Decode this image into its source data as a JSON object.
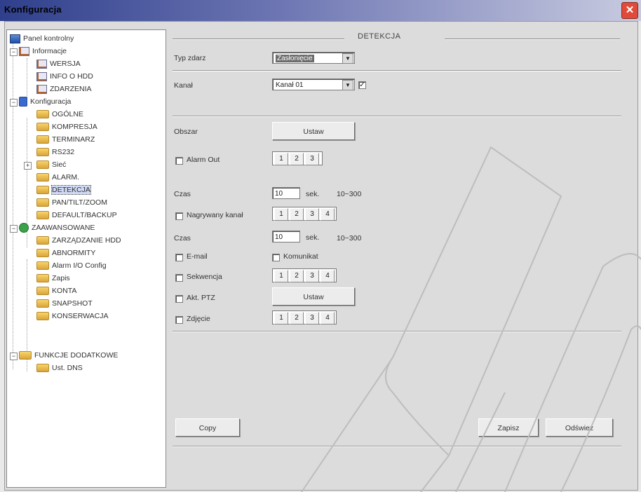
{
  "window": {
    "title": "Konfiguracja",
    "close_symbol": "✕"
  },
  "tree": {
    "items": [
      {
        "label": "Panel kontrolny",
        "icon": "panel-icon"
      },
      {
        "label": "Informacje",
        "icon": "notes-icon"
      },
      {
        "label": "WERSJA",
        "icon": "notes-icon"
      },
      {
        "label": "INFO O HDD",
        "icon": "notes-icon"
      },
      {
        "label": "ZDARZENIA",
        "icon": "notes-icon"
      },
      {
        "label": "Konfiguracja",
        "icon": "gear-icon"
      },
      {
        "label": "OGÓLNE",
        "icon": "folder-icon"
      },
      {
        "label": "KOMPRESJA",
        "icon": "folder-icon"
      },
      {
        "label": "TERMINARZ",
        "icon": "folder-icon"
      },
      {
        "label": "RS232",
        "icon": "folder-icon"
      },
      {
        "label": "Sieć",
        "icon": "folder-icon"
      },
      {
        "label": "ALARM.",
        "icon": "folder-icon"
      },
      {
        "label": "DETEKCJA",
        "icon": "folder-icon"
      },
      {
        "label": "PAN/TILT/ZOOM",
        "icon": "folder-icon"
      },
      {
        "label": "DEFAULT/BACKUP",
        "icon": "folder-icon"
      },
      {
        "label": "ZAAWANSOWANE",
        "icon": "chip-icon"
      },
      {
        "label": "ZARZĄDZANIE HDD",
        "icon": "folder-icon"
      },
      {
        "label": "ABNORMITY",
        "icon": "folder-icon"
      },
      {
        "label": "Alarm I/O Config",
        "icon": "folder-icon"
      },
      {
        "label": "Zapis",
        "icon": "folder-icon"
      },
      {
        "label": "KONTA",
        "icon": "folder-icon"
      },
      {
        "label": "SNAPSHOT",
        "icon": "folder-icon"
      },
      {
        "label": "KONSERWACJA",
        "icon": "folder-icon"
      },
      {
        "label": "FUNKCJE DODATKOWE",
        "icon": "folder-icon"
      },
      {
        "label": "Ust. DNS",
        "icon": "folder-icon"
      }
    ],
    "selected": "DETEKCJA"
  },
  "panel": {
    "section_title": "DETEKCJA",
    "typ_label": "Typ zdarz",
    "typ_value": "Zasłonięcie",
    "kanal_label": "Kanał",
    "kanal_value": "Kanał 01",
    "kanal_checked": "✓",
    "obszar_label": "Obszar",
    "ustaw_label": "Ustaw",
    "alarm_out_label": "Alarm Out",
    "czas_label": "Czas",
    "czas1_value": "10",
    "sek_label": "sek.",
    "range_label": "10~300",
    "nagrywany_label": "Nagrywany kanał",
    "czas2_value": "10",
    "email_label": "E-mail",
    "komunikat_label": "Komunikat",
    "sekwencja_label": "Sekwencja",
    "akt_ptz_label": "Akt. PTZ",
    "zdjecie_label": "Zdjęcie",
    "alarm_out_channels": [
      "1",
      "2",
      "3"
    ],
    "channels4": [
      "1",
      "2",
      "3",
      "4"
    ],
    "copy_label": "Copy",
    "zapisz_label": "Zapisz",
    "odswiez_label": "Odśwież"
  }
}
